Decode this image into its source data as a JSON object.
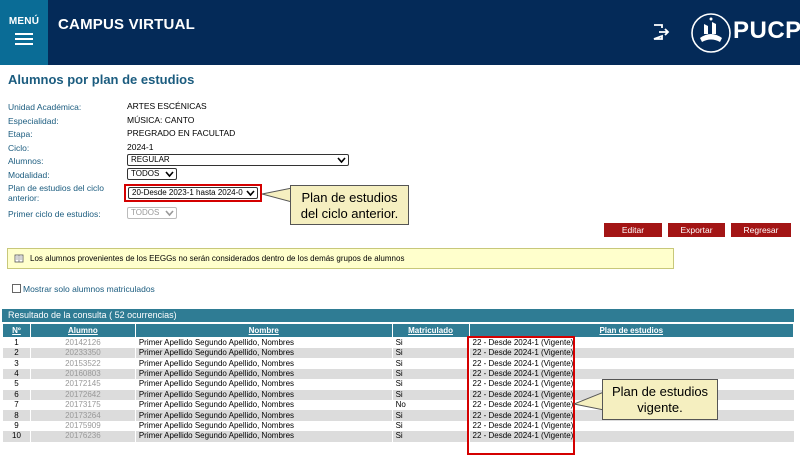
{
  "header": {
    "menu_label": "MENÚ",
    "app_title": "CAMPUS VIRTUAL",
    "logo_text": "PUCP",
    "color_bg": "#042a58",
    "color_menu": "#0a6c96"
  },
  "page": {
    "title": "Alumnos por plan de estudios"
  },
  "form": {
    "unidad_label": "Unidad Académica:",
    "unidad_value": "ARTES ESCÉNICAS",
    "especialidad_label": "Especialidad:",
    "especialidad_value": "MÚSICA: CANTO",
    "etapa_label": "Etapa:",
    "etapa_value": "PREGRADO EN FACULTAD",
    "ciclo_label": "Ciclo:",
    "ciclo_value": "2024-1",
    "alumnos_label": "Alumnos:",
    "alumnos_value": "REGULAR",
    "modalidad_label": "Modalidad:",
    "modalidad_value": "TODOS",
    "plan_label_line1": "Plan de estudios del ciclo",
    "plan_label_line2": "anterior:",
    "plan_value": "20-Desde 2023-1 hasta 2024-0",
    "primer_ciclo_label": "Primer ciclo de estudios:",
    "primer_ciclo_value": "TODOS"
  },
  "callouts": {
    "anterior_line1": "Plan de estudios",
    "anterior_line2": "del ciclo anterior.",
    "vigente_line1": "Plan de estudios",
    "vigente_line2": "vigente."
  },
  "buttons": {
    "editar": "Editar",
    "exportar": "Exportar",
    "regresar": "Regresar"
  },
  "notice": "Los alumnos provenientes de los EEGGs no serán considerados dentro de los demás grupos de alumnos",
  "checkbox_label": "Mostrar solo alumnos matriculados",
  "results": {
    "title": "Resultado de la consulta ( 52 ocurrencias)",
    "columns": [
      "Nº",
      "Alumno",
      "Nombre",
      "Matriculado",
      "Plan de estudios"
    ],
    "rows": [
      {
        "n": "1",
        "alumno": "20142126",
        "nombre": "Primer Apellido Segundo Apellido, Nombres",
        "matriculado": "Si",
        "plan": "22 - Desde 2024-1 (Vigente)"
      },
      {
        "n": "2",
        "alumno": "20233350",
        "nombre": "Primer Apellido Segundo Apellido, Nombres",
        "matriculado": "Si",
        "plan": "22 - Desde 2024-1 (Vigente)"
      },
      {
        "n": "3",
        "alumno": "20153522",
        "nombre": "Primer Apellido Segundo Apellido, Nombres",
        "matriculado": "Si",
        "plan": "22 - Desde 2024-1 (Vigente)"
      },
      {
        "n": "4",
        "alumno": "20160803",
        "nombre": "Primer Apellido Segundo Apellido, Nombres",
        "matriculado": "Si",
        "plan": "22 - Desde 2024-1 (Vigente)"
      },
      {
        "n": "5",
        "alumno": "20172145",
        "nombre": "Primer Apellido Segundo Apellido, Nombres",
        "matriculado": "Si",
        "plan": "22 - Desde 2024-1 (Vigente)"
      },
      {
        "n": "6",
        "alumno": "20172642",
        "nombre": "Primer Apellido Segundo Apellido, Nombres",
        "matriculado": "Si",
        "plan": "22 - Desde 2024-1 (Vigente)"
      },
      {
        "n": "7",
        "alumno": "20173175",
        "nombre": "Primer Apellido Segundo Apellido, Nombres",
        "matriculado": "No",
        "plan": "22 - Desde 2024-1 (Vigente)"
      },
      {
        "n": "8",
        "alumno": "20173264",
        "nombre": "Primer Apellido Segundo Apellido, Nombres",
        "matriculado": "Si",
        "plan": "22 - Desde 2024-1 (Vigente)"
      },
      {
        "n": "9",
        "alumno": "20175909",
        "nombre": "Primer Apellido Segundo Apellido, Nombres",
        "matriculado": "Si",
        "plan": "22 - Desde 2024-1 (Vigente)"
      },
      {
        "n": "10",
        "alumno": "20176236",
        "nombre": "Primer Apellido Segundo Apellido, Nombres",
        "matriculado": "Si",
        "plan": "22 - Desde 2024-1 (Vigente)"
      }
    ]
  },
  "colors": {
    "accent_red": "#a31515",
    "table_header": "#2f7c94",
    "highlight": "#d40000"
  },
  "icons": {
    "logout": "logout-icon",
    "notice": "notebook-icon",
    "dropdown": "chevron-down-icon"
  }
}
